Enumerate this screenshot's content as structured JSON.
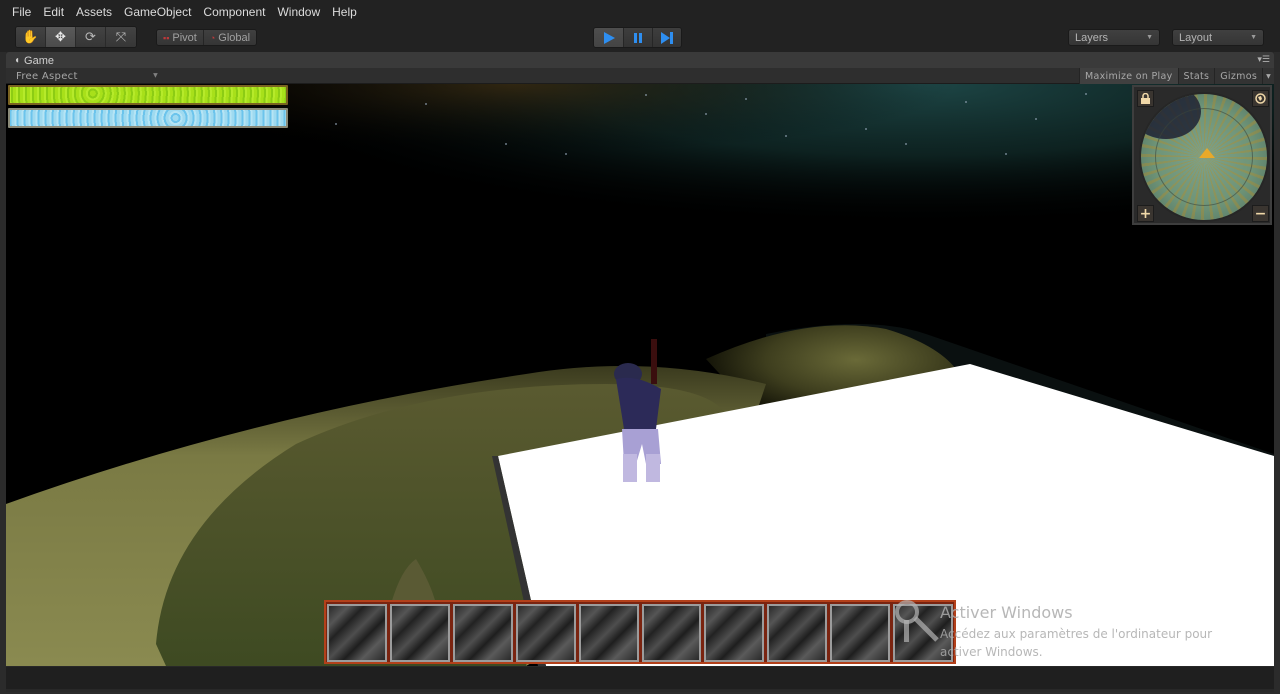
{
  "menu": {
    "items": [
      "File",
      "Edit",
      "Assets",
      "GameObject",
      "Component",
      "Window",
      "Help"
    ]
  },
  "toolbar": {
    "transform_tools": [
      {
        "name": "hand-tool",
        "icon": "hand-icon",
        "glyph": "✋",
        "active": false
      },
      {
        "name": "move-tool",
        "icon": "move-icon",
        "glyph": "✥",
        "active": true
      },
      {
        "name": "rotate-tool",
        "icon": "rotate-icon",
        "glyph": "⟳",
        "active": false
      },
      {
        "name": "scale-tool",
        "icon": "scale-icon",
        "glyph": "⤧",
        "active": false
      }
    ],
    "pivot_label": "Pivot",
    "global_label": "Global",
    "play_controls": {
      "play_active": true,
      "accent_color": "#2e8ef0"
    },
    "layers_label": "Layers",
    "layout_label": "Layout"
  },
  "game_panel": {
    "tab_label": "Game",
    "aspect_label": "Free Aspect",
    "maximize_on_play_label": "Maximize on Play",
    "stats_label": "Stats",
    "gizmos_label": "Gizmos"
  },
  "hud": {
    "health_fraction": 1.0,
    "mana_fraction": 1.0,
    "health_color": "#a8e01a",
    "mana_color": "#8ad2f0"
  },
  "minimap": {
    "zoom_in_label": "+",
    "zoom_out_label": "−",
    "player_marker_color": "#e8a92a"
  },
  "inventory": {
    "slot_count": 10,
    "border_color": "#b3401a"
  },
  "watermark": {
    "title": "Activer Windows",
    "line1": "Accédez aux paramètres de l'ordinateur pour",
    "line2": "activer Windows."
  }
}
